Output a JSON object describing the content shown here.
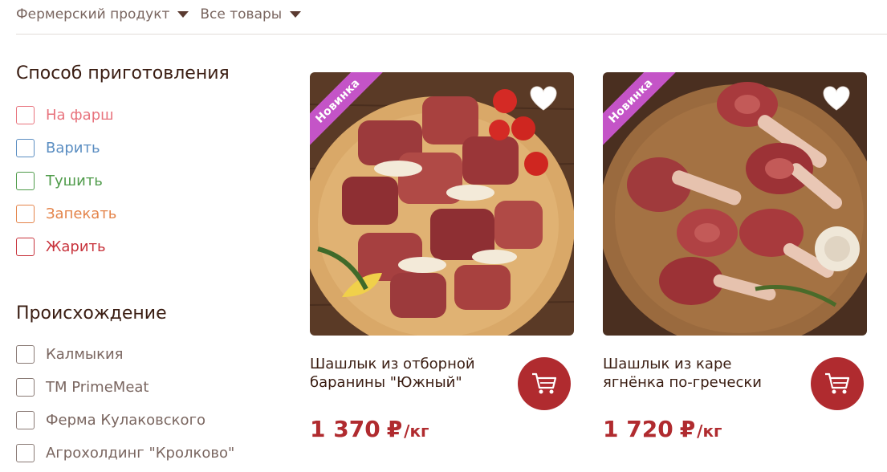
{
  "topbar": {
    "category_filter": "Фермерский продукт",
    "products_filter": "Все товары"
  },
  "cooking": {
    "title": "Способ приготовления",
    "options": [
      {
        "label": "На фарш",
        "color": "#e8737d"
      },
      {
        "label": "Варить",
        "color": "#5b8ec2"
      },
      {
        "label": "Тушить",
        "color": "#4f9b4a"
      },
      {
        "label": "Запекать",
        "color": "#e4844a"
      },
      {
        "label": "Жарить",
        "color": "#c8343d"
      }
    ]
  },
  "origin": {
    "title": "Происхождение",
    "options": [
      "Калмыкия",
      "TM PrimeMeat",
      "Ферма Кулаковского",
      "Агрохолдинг \"Кролково\""
    ]
  },
  "products": [
    {
      "badge": "Новинка",
      "name": "Шашлык из отборной баранины \"Южный\"",
      "price": "1 370",
      "currency": "₽",
      "unit": "/кг",
      "image_icon": "lamb-skewers-photo"
    },
    {
      "badge": "Новинка",
      "name": "Шашлык из каре ягнёнка по-гречески",
      "price": "1 720",
      "currency": "₽",
      "unit": "/кг",
      "image_icon": "lamb-rack-photo"
    }
  ],
  "colors": {
    "accent": "#b02b2f",
    "badge": "#c454c7",
    "text": "#3a1d12",
    "muted": "#7a6660"
  }
}
